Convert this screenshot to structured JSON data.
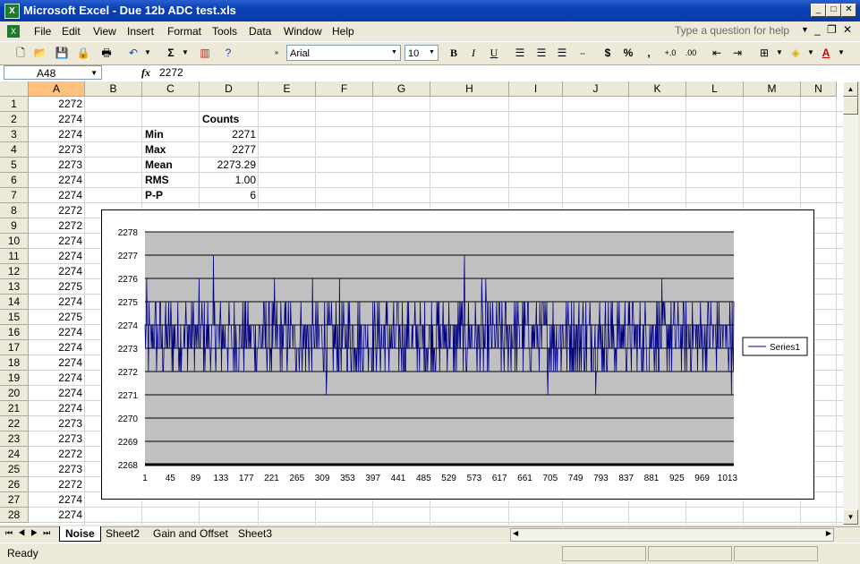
{
  "window": {
    "title": "Microsoft Excel - Due 12b ADC test.xls"
  },
  "menu": [
    "File",
    "Edit",
    "View",
    "Insert",
    "Format",
    "Tools",
    "Data",
    "Window",
    "Help"
  ],
  "ask_placeholder": "Type a question for help",
  "toolbar": {
    "font": "Arial",
    "size": "10",
    "bold": "B",
    "italic": "I",
    "underline": "U",
    "currency": "$",
    "percent": "%",
    "comma": ","
  },
  "formula_bar": {
    "name_box": "A48",
    "fx": "fx",
    "value": "2272"
  },
  "columns": [
    "A",
    "B",
    "C",
    "D",
    "E",
    "F",
    "G",
    "H",
    "I",
    "J",
    "K",
    "L",
    "M",
    "N"
  ],
  "rows": [
    1,
    2,
    3,
    4,
    5,
    6,
    7,
    8,
    9,
    10,
    11,
    12,
    13,
    14,
    15,
    16,
    17,
    18,
    19,
    20,
    21,
    22,
    23,
    24,
    25,
    26,
    27,
    28
  ],
  "col_a_values": [
    "2272",
    "2274",
    "2274",
    "2273",
    "2273",
    "2274",
    "2274",
    "2272",
    "2272",
    "2274",
    "2274",
    "2274",
    "2275",
    "2274",
    "2275",
    "2274",
    "2274",
    "2274",
    "2274",
    "2274",
    "2274",
    "2273",
    "2273",
    "2272",
    "2273",
    "2272",
    "2274",
    "2274"
  ],
  "stats": {
    "header": "Counts",
    "labels": [
      "Min",
      "Max",
      "Mean",
      "RMS",
      "P-P"
    ],
    "values": [
      "2271",
      "2277",
      "2273.29",
      "1.00",
      "6"
    ]
  },
  "chart_data": {
    "type": "line",
    "series": [
      {
        "name": "Series1"
      }
    ],
    "ylim": [
      2268,
      2278
    ],
    "yticks": [
      2268,
      2269,
      2270,
      2271,
      2272,
      2273,
      2274,
      2275,
      2276,
      2277,
      2278
    ],
    "x_range": [
      1,
      1024
    ],
    "xticks": [
      1,
      45,
      89,
      133,
      177,
      221,
      265,
      309,
      353,
      397,
      441,
      485,
      529,
      573,
      617,
      661,
      705,
      749,
      793,
      837,
      881,
      925,
      969,
      1013
    ],
    "grid": true,
    "legend": "right",
    "plot_bg": "#c0c0c0",
    "line_color": "#000080"
  },
  "sheet_tabs": [
    "Noise",
    "Sheet2",
    "Gain and Offset",
    "Sheet3"
  ],
  "status": "Ready"
}
